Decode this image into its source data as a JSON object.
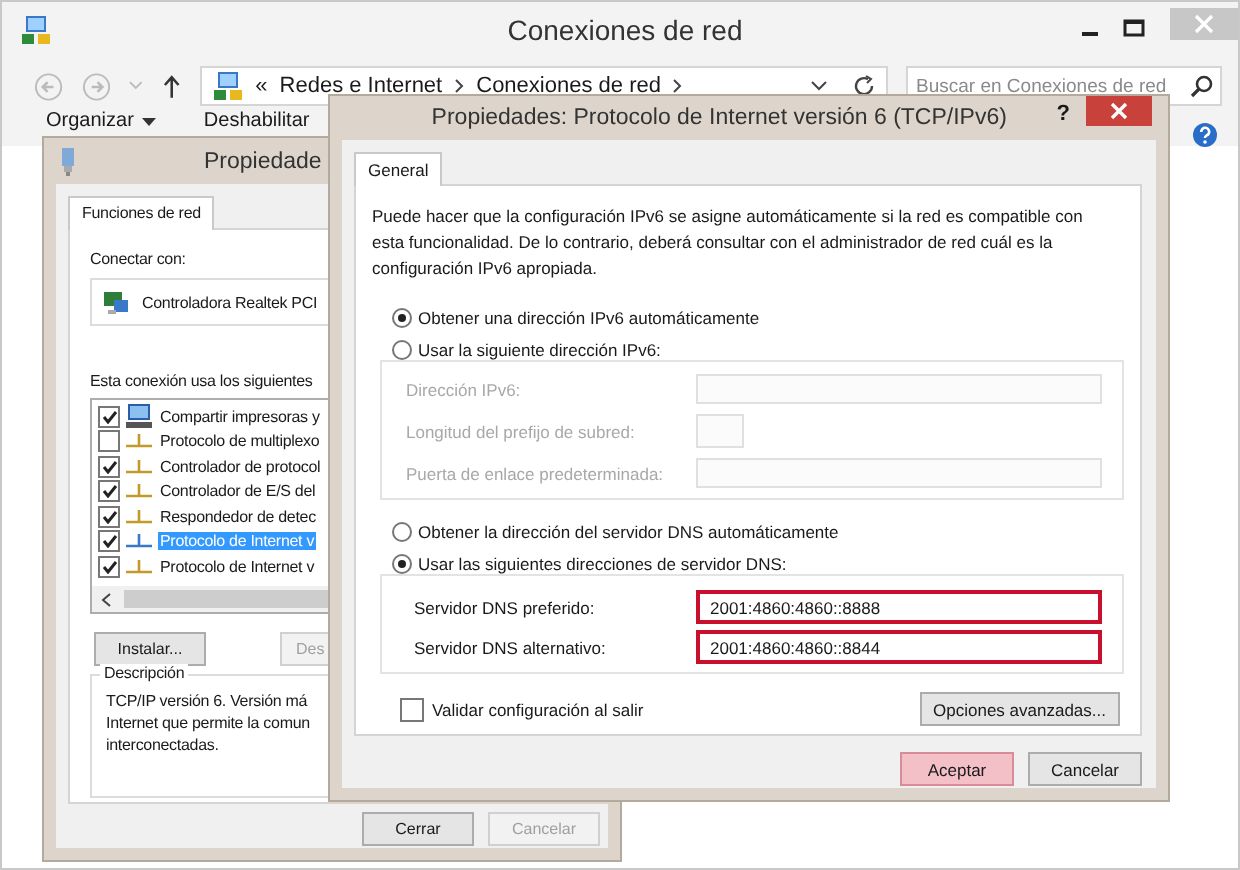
{
  "window": {
    "title": "Conexiones de red"
  },
  "address_bar": {
    "overflow": "«",
    "breadcrumbs": [
      "Redes e Internet",
      "Conexiones de red"
    ]
  },
  "search": {
    "placeholder": "Buscar en Conexiones de red"
  },
  "toolbar": {
    "items": [
      {
        "label": "Organizar",
        "menu": true
      },
      {
        "label": "Deshabilitar",
        "menu": false
      }
    ]
  },
  "back_dialog": {
    "title": "Propiedade",
    "tabs": [
      {
        "label": "Funciones de red",
        "selected": true
      }
    ],
    "connect_label": "Conectar con:",
    "adapter": "Controladora Realtek PCI",
    "components_label": "Esta conexión usa los siguientes",
    "components": [
      {
        "label": "Compartir impresoras y",
        "kind": "service",
        "checked": true,
        "selected": false
      },
      {
        "label": "Protocolo de multiplexo",
        "kind": "protocol",
        "checked": false,
        "selected": false
      },
      {
        "label": "Controlador de protocol",
        "kind": "protocol",
        "checked": true,
        "selected": false
      },
      {
        "label": "Controlador de E/S del",
        "kind": "protocol",
        "checked": true,
        "selected": false
      },
      {
        "label": "Respondedor de detec",
        "kind": "protocol",
        "checked": true,
        "selected": false
      },
      {
        "label": "Protocolo de Internet v",
        "kind": "protocol",
        "checked": true,
        "selected": true
      },
      {
        "label": "Protocolo de Internet v",
        "kind": "protocol",
        "checked": true,
        "selected": false
      }
    ],
    "buttons": [
      {
        "label": "Instalar...",
        "disabled": false
      },
      {
        "label": "Des",
        "disabled": true
      }
    ],
    "description": {
      "title": "Descripción",
      "lines": [
        "TCP/IP versión 6. Versión má",
        "Internet que permite la comun",
        "interconectadas."
      ]
    },
    "footer_buttons": [
      {
        "label": "Cerrar",
        "disabled": false
      },
      {
        "label": "Cancelar",
        "disabled": true
      }
    ]
  },
  "front_dialog": {
    "title": "Propiedades: Protocolo de Internet versión 6 (TCP/IPv6)",
    "help": "?",
    "tabs": [
      {
        "label": "General",
        "selected": true
      }
    ],
    "intro": "Puede hacer que la configuración IPv6 se asigne automáticamente si la red es compatible con esta funcionalidad. De lo contrario, deberá consultar con el administrador de red cuál es la configuración IPv6 apropiada.",
    "address_mode": [
      {
        "label": "Obtener una dirección IPv6 automáticamente",
        "selected": true
      },
      {
        "label": "Usar la siguiente dirección IPv6:",
        "selected": false
      }
    ],
    "address_fields": [
      {
        "label": "Dirección IPv6:",
        "kind": "wide",
        "disabled": true
      },
      {
        "label": "Longitud del prefijo de subred:",
        "kind": "short",
        "disabled": true
      },
      {
        "label": "Puerta de enlace predeterminada:",
        "kind": "wide",
        "disabled": true
      }
    ],
    "dns_mode": [
      {
        "label": "Obtener la dirección del servidor DNS automáticamente",
        "selected": false
      },
      {
        "label": "Usar las siguientes direcciones de servidor DNS:",
        "selected": true
      }
    ],
    "dns_fields": [
      {
        "label": "Servidor DNS preferido:",
        "value": "2001:4860:4860::8888",
        "highlighted": true
      },
      {
        "label": "Servidor DNS alternativo:",
        "value": "2001:4860:4860::8844",
        "highlighted": true
      }
    ],
    "validate": {
      "label": "Validar configuración al salir",
      "checked": false
    },
    "advanced_button": "Opciones avanzadas...",
    "buttons": [
      {
        "label": "Aceptar",
        "default": true
      },
      {
        "label": "Cancelar",
        "default": false
      }
    ]
  }
}
